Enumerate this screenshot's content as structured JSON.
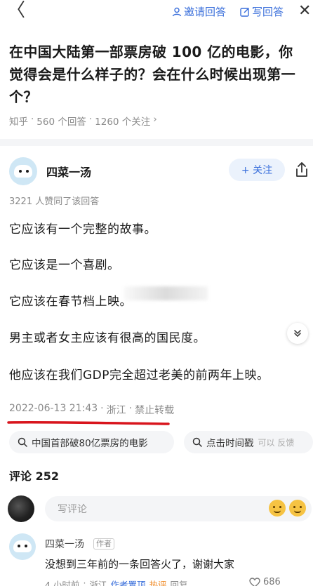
{
  "topbar": {
    "back_glyph": "〈",
    "invite_label": "邀请回答",
    "write_label": "写回答",
    "close_glyph": "✕"
  },
  "question": {
    "title": "在中国大陆第一部票房破 100 亿的电影，你觉得会是什么样子的？会在什么时候出现第一个？",
    "source": "知乎",
    "answers": "560 个回答",
    "followers": "1260 个关注",
    "chevron": "›"
  },
  "answer": {
    "author": "四菜一汤",
    "follow_label": "+ 关注",
    "likes": "3221 人赞同了该回答",
    "paragraphs": [
      "它应该有一个完整的故事。",
      "它应该是一个喜剧。",
      "它应该在春节档上映。",
      "男主或者女主应该有很高的国民度。",
      "他应该在我们GDP完全超过老美的前两年上映。"
    ],
    "date": "2022-06-13 21:43",
    "location": "浙江",
    "rights": "禁止转载"
  },
  "searches": [
    {
      "label": "中国首部破80亿票房的电影"
    },
    {
      "label": "点击时间戳",
      "sub": "可以 反馈"
    }
  ],
  "comments": {
    "header": "评论 252",
    "input_placeholder": "写评论",
    "items": [
      {
        "author": "四菜一汤",
        "badge": "作者",
        "text": "没想到三年前的一条回答火了，谢谢大家",
        "time": "4 小时前",
        "location": "浙江",
        "pin_label": "作者置顶",
        "hot_label": "热评",
        "reply_label": "回复",
        "likes": "686"
      }
    ]
  },
  "colors": {
    "accent": "#3a6fdb",
    "annotation_red": "#d8141c"
  }
}
